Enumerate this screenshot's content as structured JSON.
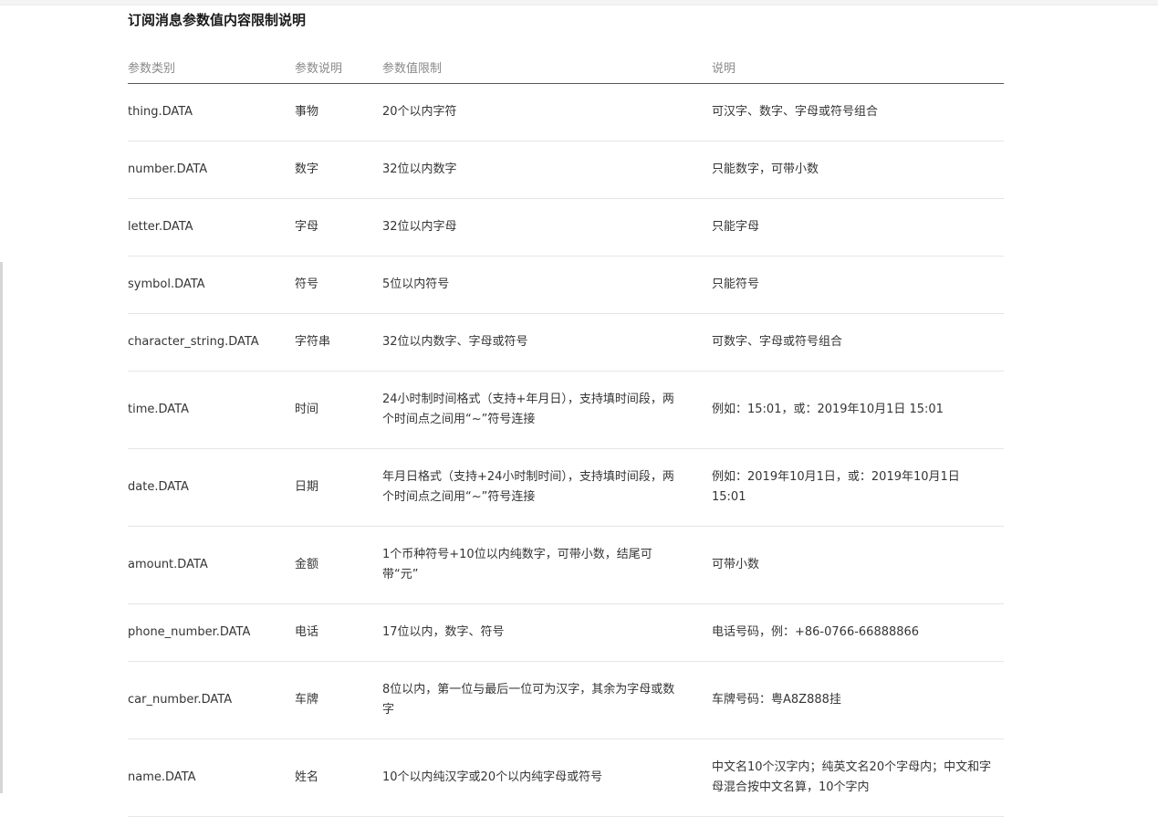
{
  "section": {
    "title": "订阅消息参数值内容限制说明"
  },
  "table": {
    "headers": [
      "参数类别",
      "参数说明",
      "参数值限制",
      "说明"
    ],
    "rows": [
      [
        "thing.DATA",
        "事物",
        "20个以内字符",
        "可汉字、数字、字母或符号组合"
      ],
      [
        "number.DATA",
        "数字",
        "32位以内数字",
        "只能数字，可带小数"
      ],
      [
        "letter.DATA",
        "字母",
        "32位以内字母",
        "只能字母"
      ],
      [
        "symbol.DATA",
        "符号",
        "5位以内符号",
        "只能符号"
      ],
      [
        "character_string.DATA",
        "字符串",
        "32位以内数字、字母或符号",
        "可数字、字母或符号组合"
      ],
      [
        "time.DATA",
        "时间",
        "24小时制时间格式（支持+年月日），支持填时间段，两个时间点之间用“~”符号连接",
        "例如：15:01，或：2019年10月1日 15:01"
      ],
      [
        "date.DATA",
        "日期",
        "年月日格式（支持+24小时制时间），支持填时间段，两个时间点之间用“~”符号连接",
        "例如：2019年10月1日，或：2019年10月1日 15:01"
      ],
      [
        "amount.DATA",
        "金额",
        "1个币种符号+10位以内纯数字，可带小数，结尾可带“元”",
        "可带小数"
      ],
      [
        "phone_number.DATA",
        "电话",
        "17位以内，数字、符号",
        "电话号码，例：+86-0766-66888866"
      ],
      [
        "car_number.DATA",
        "车牌",
        "8位以内，第一位与最后一位可为汉字，其余为字母或数字",
        "车牌号码：粤A8Z888挂"
      ],
      [
        "name.DATA",
        "姓名",
        "10个以内纯汉字或20个以内纯字母或符号",
        "中文名10个汉字内；纯英文名20个字母内；中文和字母混合按中文名算，10个字内"
      ]
    ]
  }
}
